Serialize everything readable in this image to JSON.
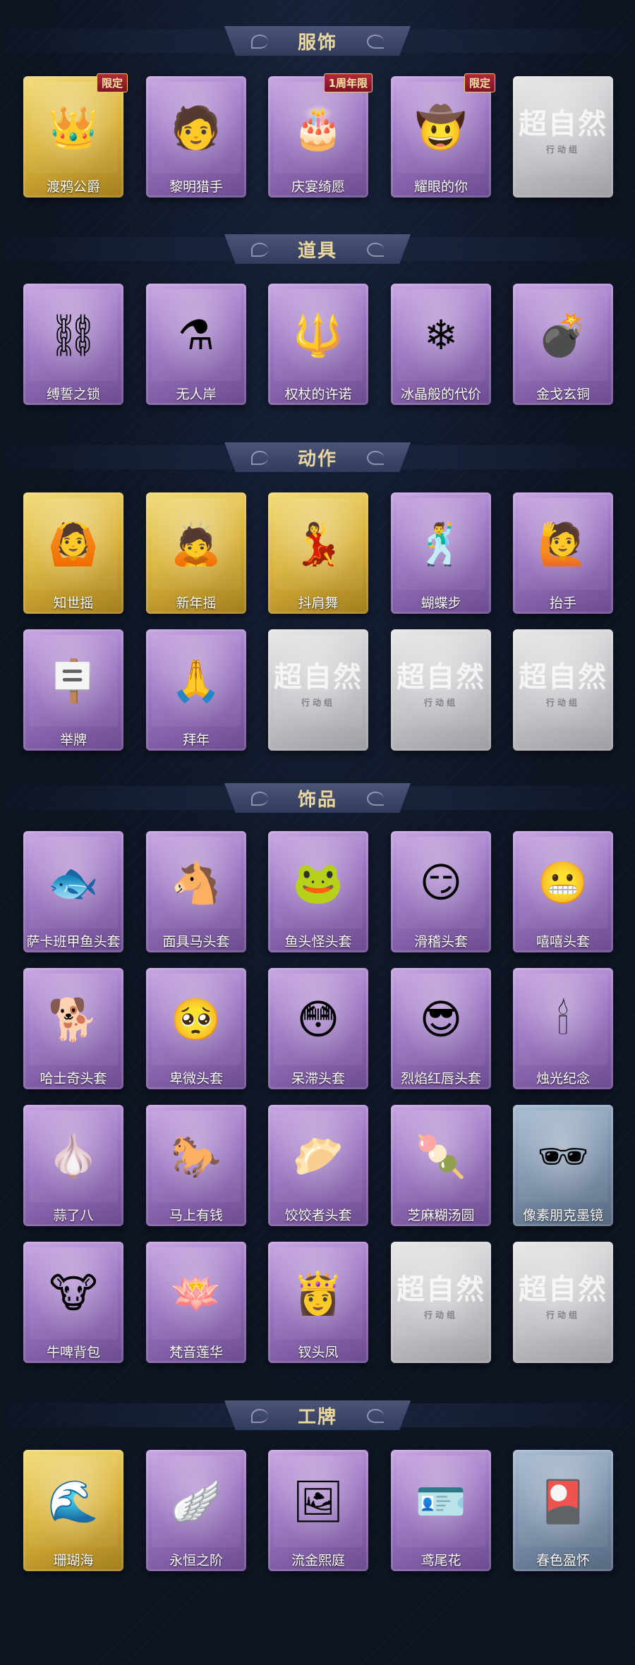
{
  "sections": [
    {
      "title": "服饰",
      "rows": [
        [
          {
            "label": "渡鸦公爵",
            "theme": "gold",
            "icon": "portrait-icon",
            "glyph": "👑",
            "tag": "限定"
          },
          {
            "label": "黎明猎手",
            "theme": "purple",
            "icon": "portrait-icon",
            "glyph": "🧑"
          },
          {
            "label": "庆宴绮愿",
            "theme": "purple",
            "icon": "portrait-icon",
            "glyph": "🎂",
            "tag": "1周年限"
          },
          {
            "label": "耀眼的你",
            "theme": "purple",
            "icon": "portrait-icon",
            "glyph": "🤠",
            "tag": "限定"
          },
          {
            "label": "",
            "theme": "gray",
            "icon": "placeholder-icon",
            "placeholder": "超自然",
            "sub": "行动组"
          }
        ]
      ]
    },
    {
      "title": "道具",
      "rows": [
        [
          {
            "label": "缚誓之锁",
            "theme": "purple",
            "icon": "chain-icon",
            "glyph": "⛓"
          },
          {
            "label": "无人岸",
            "theme": "purple",
            "icon": "potion-icon",
            "glyph": "⚗"
          },
          {
            "label": "权杖的许诺",
            "theme": "purple",
            "icon": "scepter-icon",
            "glyph": "🔱"
          },
          {
            "label": "冰晶般的代价",
            "theme": "purple",
            "icon": "lotus-icon",
            "glyph": "❄"
          },
          {
            "label": "金戈玄铜",
            "theme": "purple",
            "icon": "grenade-icon",
            "glyph": "💣"
          }
        ]
      ]
    },
    {
      "title": "动作",
      "rows": [
        [
          {
            "label": "知世摇",
            "theme": "gold",
            "icon": "pose-icon",
            "glyph": "🙆"
          },
          {
            "label": "新年摇",
            "theme": "gold",
            "icon": "pose-icon",
            "glyph": "🙇"
          },
          {
            "label": "抖肩舞",
            "theme": "gold",
            "icon": "pose-icon",
            "glyph": "💃"
          },
          {
            "label": "蝴蝶步",
            "theme": "purple",
            "icon": "pose-icon",
            "glyph": "🕺"
          },
          {
            "label": "抬手",
            "theme": "purple",
            "icon": "pose-icon",
            "glyph": "🙋"
          }
        ],
        [
          {
            "label": "举牌",
            "theme": "purple",
            "icon": "pose-icon",
            "glyph": "🪧"
          },
          {
            "label": "拜年",
            "theme": "purple",
            "icon": "pose-icon",
            "glyph": "🙏"
          },
          {
            "label": "",
            "theme": "gray",
            "icon": "placeholder-icon",
            "placeholder": "超自然",
            "sub": "行动组"
          },
          {
            "label": "",
            "theme": "gray",
            "icon": "placeholder-icon",
            "placeholder": "超自然",
            "sub": "行动组"
          },
          {
            "label": "",
            "theme": "gray",
            "icon": "placeholder-icon",
            "placeholder": "超自然",
            "sub": "行动组"
          }
        ]
      ]
    },
    {
      "title": "饰品",
      "rows": [
        [
          {
            "label": "萨卡班甲鱼头套",
            "theme": "purple",
            "icon": "fish-head-icon",
            "glyph": "🐟"
          },
          {
            "label": "面具马头套",
            "theme": "purple",
            "icon": "horse-head-icon",
            "glyph": "🐴"
          },
          {
            "label": "鱼头怪头套",
            "theme": "purple",
            "icon": "fish-monster-icon",
            "glyph": "🐸"
          },
          {
            "label": "滑稽头套",
            "theme": "purple",
            "icon": "smirk-face-icon",
            "glyph": "😏"
          },
          {
            "label": "嘻嘻头套",
            "theme": "purple",
            "icon": "grin-face-icon",
            "glyph": "😬"
          }
        ],
        [
          {
            "label": "哈士奇头套",
            "theme": "purple",
            "icon": "dog-head-icon",
            "glyph": "🐕"
          },
          {
            "label": "卑微头套",
            "theme": "purple",
            "icon": "sad-face-icon",
            "glyph": "🥺"
          },
          {
            "label": "呆滞头套",
            "theme": "purple",
            "icon": "flushed-face-icon",
            "glyph": "😳"
          },
          {
            "label": "烈焰红唇头套",
            "theme": "purple",
            "icon": "pikachu-icon",
            "glyph": "😎"
          },
          {
            "label": "烛光纪念",
            "theme": "purple",
            "icon": "candle-icon",
            "glyph": "🕯"
          }
        ],
        [
          {
            "label": "蒜了八",
            "theme": "purple",
            "icon": "garlic-icon",
            "glyph": "🧄"
          },
          {
            "label": "马上有钱",
            "theme": "purple",
            "icon": "horse-plush-icon",
            "glyph": "🐎"
          },
          {
            "label": "饺饺者头套",
            "theme": "purple",
            "icon": "dumpling-icon",
            "glyph": "🥟"
          },
          {
            "label": "芝麻糊汤圆",
            "theme": "purple",
            "icon": "tangyuan-icon",
            "glyph": "🍡"
          },
          {
            "label": "像素朋克墨镜",
            "theme": "blue",
            "icon": "pixel-sunglasses-icon",
            "glyph": "🕶"
          }
        ],
        [
          {
            "label": "牛啤背包",
            "theme": "purple",
            "icon": "cow-backpack-icon",
            "glyph": "🐮"
          },
          {
            "label": "梵音莲华",
            "theme": "purple",
            "icon": "lotus-doll-icon",
            "glyph": "🪷"
          },
          {
            "label": "钗头凤",
            "theme": "purple",
            "icon": "phoenix-crown-icon",
            "glyph": "👸"
          },
          {
            "label": "",
            "theme": "gray",
            "icon": "placeholder-icon",
            "placeholder": "超自然",
            "sub": "行动组"
          },
          {
            "label": "",
            "theme": "gray",
            "icon": "placeholder-icon",
            "placeholder": "超自然",
            "sub": "行动组"
          }
        ]
      ]
    },
    {
      "title": "工牌",
      "rows": [
        [
          {
            "label": "珊瑚海",
            "theme": "gold",
            "icon": "badge-icon",
            "glyph": "🌊"
          },
          {
            "label": "永恒之阶",
            "theme": "purple",
            "icon": "badge-icon",
            "glyph": "🪽"
          },
          {
            "label": "流金熙庭",
            "theme": "purple",
            "icon": "badge-icon",
            "glyph": "🖼"
          },
          {
            "label": "鸢尾花",
            "theme": "purple",
            "icon": "badge-icon",
            "glyph": "🪪"
          },
          {
            "label": "春色盈怀",
            "theme": "blue",
            "icon": "badge-icon",
            "glyph": "🎴"
          }
        ]
      ]
    }
  ]
}
